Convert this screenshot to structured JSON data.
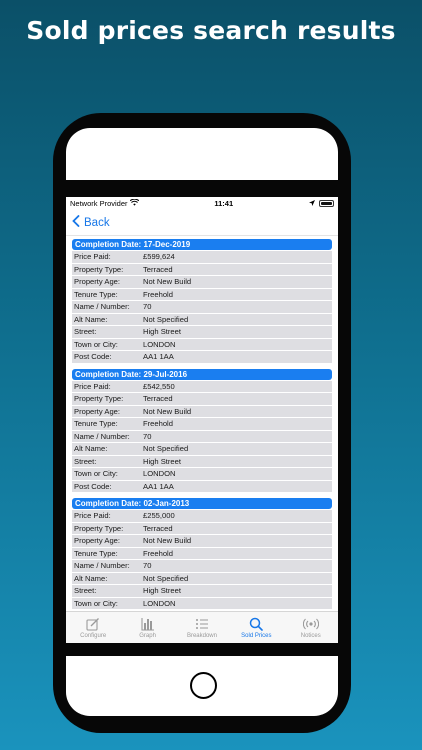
{
  "headline": "Sold prices search results",
  "status": {
    "carrier": "Network Provider",
    "time": "11:41"
  },
  "nav": {
    "back_label": "Back"
  },
  "sections": [
    {
      "header": "Completion Date: 17-Dec-2019",
      "rows": [
        {
          "key": "Price Paid:",
          "value": "£599,624"
        },
        {
          "key": "Property Type:",
          "value": "Terraced"
        },
        {
          "key": "Property Age:",
          "value": "Not New Build"
        },
        {
          "key": "Tenure Type:",
          "value": "Freehold"
        },
        {
          "key": "Name / Number:",
          "value": "70"
        },
        {
          "key": "Alt Name:",
          "value": "Not Specified"
        },
        {
          "key": "Street:",
          "value": "High Street"
        },
        {
          "key": "Town or City:",
          "value": "LONDON"
        },
        {
          "key": "Post Code:",
          "value": "AA1 1AA"
        }
      ]
    },
    {
      "header": "Completion Date: 29-Jul-2016",
      "rows": [
        {
          "key": "Price Paid:",
          "value": "£542,550"
        },
        {
          "key": "Property Type:",
          "value": "Terraced"
        },
        {
          "key": "Property Age:",
          "value": "Not New Build"
        },
        {
          "key": "Tenure Type:",
          "value": "Freehold"
        },
        {
          "key": "Name / Number:",
          "value": "70"
        },
        {
          "key": "Alt Name:",
          "value": "Not Specified"
        },
        {
          "key": "Street:",
          "value": "High Street"
        },
        {
          "key": "Town or City:",
          "value": "LONDON"
        },
        {
          "key": "Post Code:",
          "value": "AA1 1AA"
        }
      ]
    },
    {
      "header": "Completion Date: 02-Jan-2013",
      "rows": [
        {
          "key": "Price Paid:",
          "value": "£255,000"
        },
        {
          "key": "Property Type:",
          "value": "Terraced"
        },
        {
          "key": "Property Age:",
          "value": "Not New Build"
        },
        {
          "key": "Tenure Type:",
          "value": "Freehold"
        },
        {
          "key": "Name / Number:",
          "value": "70"
        },
        {
          "key": "Alt Name:",
          "value": "Not Specified"
        },
        {
          "key": "Street:",
          "value": "High Street"
        },
        {
          "key": "Town or City:",
          "value": "LONDON"
        }
      ]
    }
  ],
  "tabs": [
    {
      "label": "Configure",
      "icon": "edit-icon",
      "active": false
    },
    {
      "label": "Graph",
      "icon": "bar-chart-icon",
      "active": false
    },
    {
      "label": "Breakdown",
      "icon": "list-icon",
      "active": false
    },
    {
      "label": "Sold Prices",
      "icon": "search-icon",
      "active": true
    },
    {
      "label": "Notices",
      "icon": "broadcast-icon",
      "active": false
    }
  ],
  "colors": {
    "accent": "#1777e8",
    "section_header": "#1a7ef0",
    "row_bg": "#dedee2",
    "background_top": "#0b5068",
    "background_bottom": "#1a93bd"
  }
}
